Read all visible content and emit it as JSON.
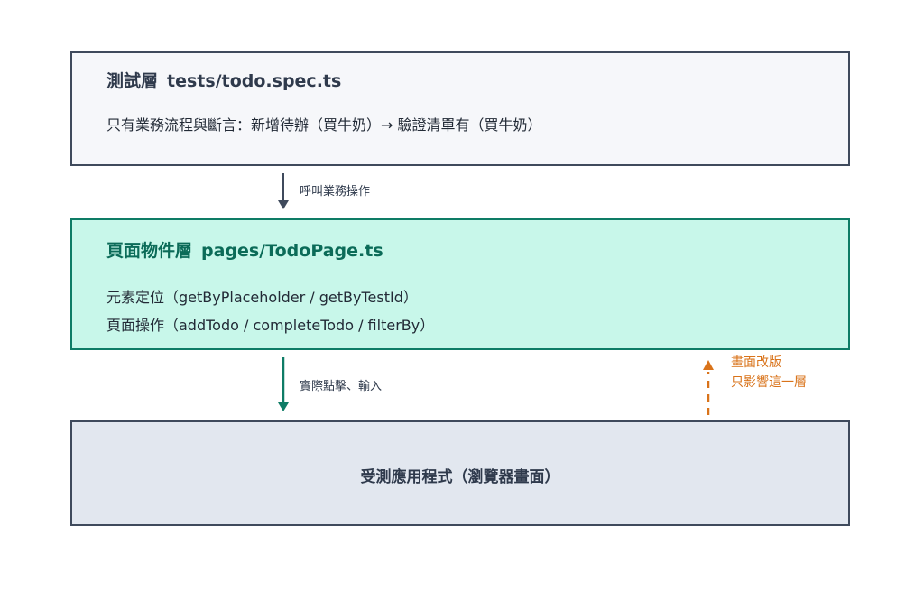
{
  "test_layer": {
    "title": "測試層",
    "code": "tests/todo.spec.ts",
    "description": "只有業務流程與斷言：新增待辦（買牛奶）→ 驗證清單有（買牛奶）"
  },
  "arrow_call": {
    "label": "呼叫業務操作"
  },
  "page_object_layer": {
    "title": "頁面物件層",
    "code": "pages/TodoPage.ts",
    "lines": [
      "元素定位（getByPlaceholder / getByTestId）",
      "頁面操作（addTodo / completeTodo / filterBy）"
    ]
  },
  "arrow_interact": {
    "label": "實際點擊、輸入"
  },
  "ui_change_note": {
    "lines": [
      "畫面改版",
      "只影響這一層"
    ]
  },
  "app_layer": {
    "title": "受測應用程式（瀏覽器畫面）"
  },
  "colors": {
    "border_dark": "#3f4a5c",
    "teal": "#0e7c66",
    "orange": "#d9731a",
    "test_bg": "#f6f7fa",
    "page_bg": "#c8f7ea",
    "app_bg": "#e2e7ef"
  }
}
